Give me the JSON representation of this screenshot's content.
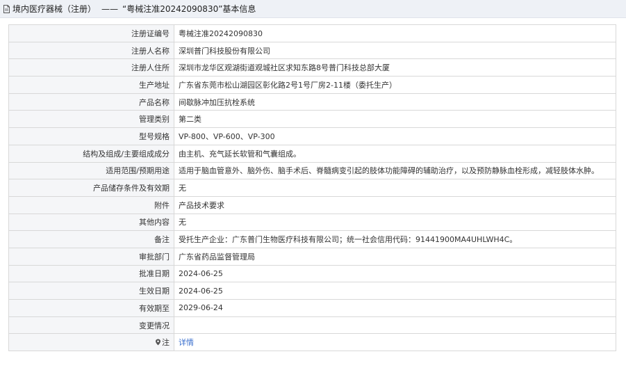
{
  "header": {
    "category": "境内医疗器械（注册）",
    "separator": "——",
    "title": "“粤械注准20242090830”基本信息"
  },
  "rows": [
    {
      "label": "注册证编号",
      "value": "粤械注准20242090830"
    },
    {
      "label": "注册人名称",
      "value": "深圳普门科技股份有限公司"
    },
    {
      "label": "注册人住所",
      "value": "深圳市龙华区观湖街道观城社区求知东路8号普门科技总部大厦"
    },
    {
      "label": "生产地址",
      "value": "广东省东莞市松山湖园区彰化路2号1号厂房2-11楼（委托生产）"
    },
    {
      "label": "产品名称",
      "value": "间歇脉冲加压抗栓系统"
    },
    {
      "label": "管理类别",
      "value": "第二类"
    },
    {
      "label": "型号规格",
      "value": "VP-800、VP-600、VP-300"
    },
    {
      "label": "结构及组成/主要组成成分",
      "value": "由主机、充气延长软管和气囊组成。"
    },
    {
      "label": "适用范围/预期用途",
      "value": "适用于脑血管意外、脑外伤、脑手术后、脊髓病变引起的肢体功能障碍的辅助治疗，以及预防静脉血栓形成，减轻肢体水肿。"
    },
    {
      "label": "产品储存条件及有效期",
      "value": "无"
    },
    {
      "label": "附件",
      "value": "产品技术要求"
    },
    {
      "label": "其他内容",
      "value": "无"
    },
    {
      "label": "备注",
      "value": "受托生产企业：广东普门生物医疗科技有限公司；统一社会信用代码：91441900MA4UHLWH4C。"
    },
    {
      "label": "审批部门",
      "value": "广东省药品监督管理局"
    },
    {
      "label": "批准日期",
      "value": "2024-06-25"
    },
    {
      "label": "生效日期",
      "value": "2024-06-25"
    },
    {
      "label": "有效期至",
      "value": "2029-06-24"
    },
    {
      "label": "变更情况",
      "value": ""
    }
  ],
  "note_row": {
    "icon": "map-pin-icon",
    "label": "注",
    "link_label": "详情"
  },
  "colors": {
    "header_bg": "#eef1f6",
    "label_bg": "#f5f6f8",
    "border": "#d8d8d8",
    "link": "#3a6fcd"
  }
}
